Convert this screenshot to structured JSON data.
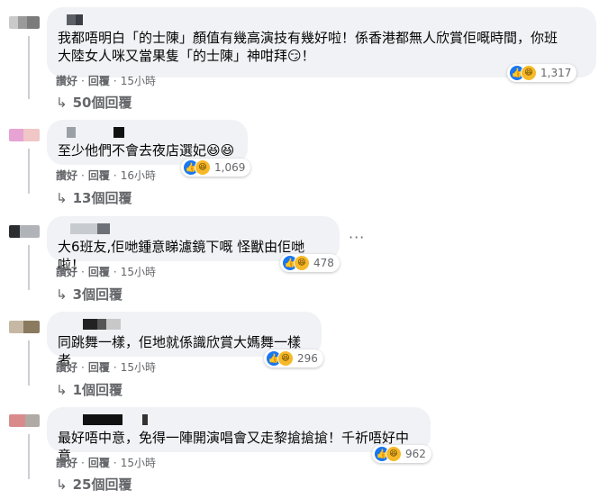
{
  "comments": [
    {
      "text": "我都唔明白「的士陳」顏值有幾高演技有幾好啦！係香港都無人欣賞佢嘅時間，你班\n大陸女人咪又當果隻「的士陳」神咁拜😏！",
      "reactions": {
        "count": "1,317",
        "icons": [
          "like-icon",
          "haha-icon"
        ]
      },
      "actions": {
        "like": "讚好",
        "reply": "回覆",
        "time": "15小時"
      },
      "replies": "50個回覆"
    },
    {
      "text": "至少他們不會去夜店選妃😆😆",
      "reactions": {
        "count": "1,069",
        "icons": [
          "like-icon",
          "haha-icon"
        ]
      },
      "actions": {
        "like": "讚好",
        "reply": "回覆",
        "time": "16小時"
      },
      "replies": "13個回覆"
    },
    {
      "text": "大6班友,佢哋鍾意睇濾鏡下嘅 怪獸由佢哋啦！",
      "reactions": {
        "count": "478",
        "icons": [
          "like-icon",
          "haha-icon"
        ]
      },
      "actions": {
        "like": "讚好",
        "reply": "回覆",
        "time": "15小時"
      },
      "replies": "3個回覆",
      "more": "···"
    },
    {
      "text": "同跳舞一樣，佢地就係識欣賞大媽舞一樣者",
      "reactions": {
        "count": "296",
        "icons": [
          "like-icon",
          "haha-icon"
        ]
      },
      "actions": {
        "like": "讚好",
        "reply": "回覆",
        "time": "15小時"
      },
      "replies": "1個回覆"
    },
    {
      "text": "最好唔中意，免得一陣開演唱會又走黎搶搶搶！千祈唔好中意",
      "reactions": {
        "count": "962",
        "icons": [
          "like-icon",
          "haha-icon"
        ]
      },
      "actions": {
        "like": "讚好",
        "reply": "回覆",
        "time": "15小時"
      },
      "replies": "25個回覆"
    }
  ],
  "colors": {
    "bubble": "#f0f2f5",
    "meta": "#65676b",
    "like": "#1877f2",
    "haha": "#f7b928"
  }
}
